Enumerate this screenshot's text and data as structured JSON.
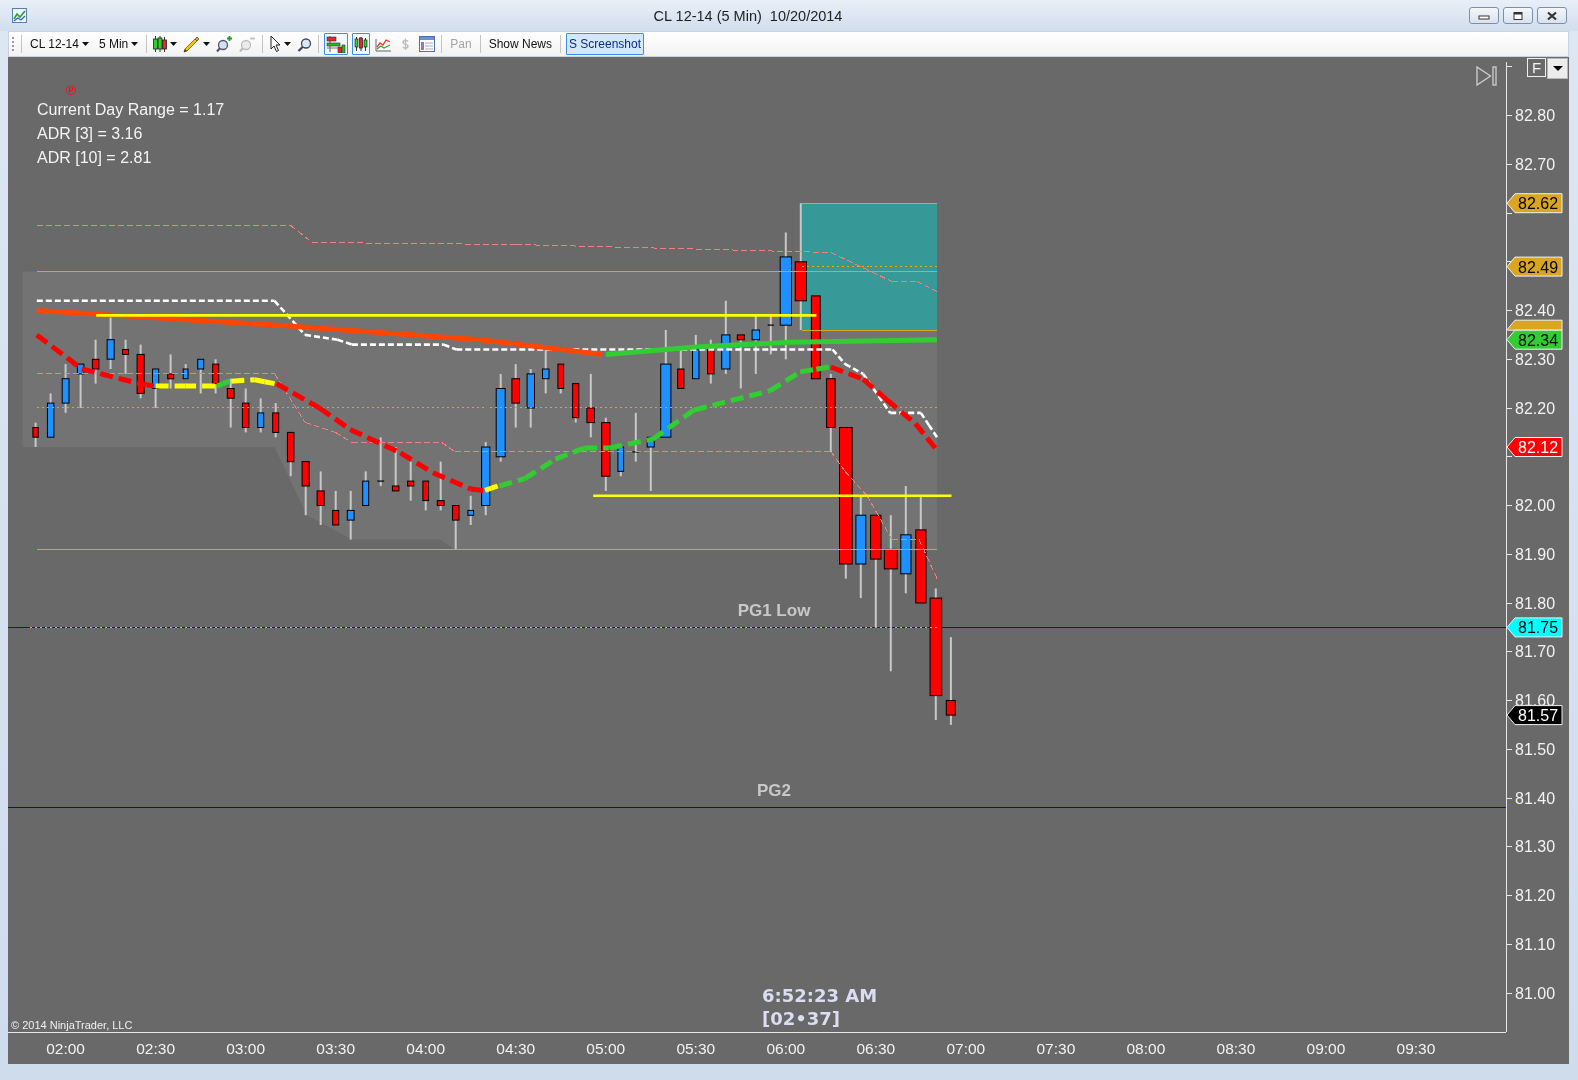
{
  "window": {
    "title": "CL 12-14 (5 Min)  10/20/2014"
  },
  "toolbar": [
    {
      "kind": "grip"
    },
    {
      "kind": "separator"
    },
    {
      "kind": "dropdown",
      "label": "CL 12-14",
      "selected": false,
      "disabled": false
    },
    {
      "kind": "dropdown",
      "label": "5 Min",
      "selected": false,
      "disabled": false
    },
    {
      "kind": "separator"
    },
    {
      "kind": "icon_dropdown",
      "selected": false,
      "disabled": false
    },
    {
      "kind": "icon_dropdown",
      "selected": false,
      "disabled": false
    },
    {
      "kind": "icon",
      "selected": false,
      "disabled": false
    },
    {
      "kind": "icon",
      "selected": false,
      "disabled": true
    },
    {
      "kind": "separator"
    },
    {
      "kind": "icon_dropdown",
      "selected": false,
      "disabled": false
    },
    {
      "kind": "icon",
      "selected": false,
      "disabled": false
    },
    {
      "kind": "separator"
    },
    {
      "kind": "icon",
      "selected": true,
      "disabled": false
    },
    {
      "kind": "icon",
      "selected": true,
      "disabled": false
    },
    {
      "kind": "icon",
      "selected": false,
      "disabled": false
    },
    {
      "kind": "icon",
      "selected": false,
      "disabled": true
    },
    {
      "kind": "icon",
      "selected": false,
      "disabled": false
    },
    {
      "kind": "separator"
    },
    {
      "kind": "text",
      "label": "Pan",
      "selected": false,
      "disabled": true
    },
    {
      "kind": "separator"
    },
    {
      "kind": "text",
      "label": "Show News",
      "selected": false,
      "disabled": false
    },
    {
      "kind": "separator"
    },
    {
      "kind": "text",
      "label": "S Screenshot",
      "selected": true,
      "disabled": false
    }
  ],
  "chart": {
    "overlay": {
      "marker": "℗",
      "info_lines": [
        "Current Day Range = 1.17",
        "ADR [3] = 3.16",
        "ADR [10] = 2.81"
      ],
      "clock": "6:52:23 AM",
      "bar_timer": "[02•37]",
      "copyright": "© 2014 NinjaTrader, LLC",
      "scale_button": "F"
    },
    "price_tags": [
      {
        "label": "82.62",
        "color": "#daa520"
      },
      {
        "label": "82.49",
        "color": "#daa520"
      },
      {
        "color": "#daa520"
      },
      {
        "label": "82.34",
        "color": "#32cd32"
      },
      {
        "label": "82.12",
        "color": "#ff0000"
      },
      {
        "label": "81.75",
        "color": "#00ffff"
      },
      {
        "label": "81.57",
        "color": "#000000"
      }
    ],
    "chart_data": {
      "type": "candlestick",
      "xlim": [
        1.68,
        10
      ],
      "ylim": [
        80.92,
        82.92
      ],
      "x": [
        1.8333,
        1.9167,
        2,
        2.0833,
        2.1667,
        2.25,
        2.3333,
        2.4167,
        2.5,
        2.5833,
        2.6667,
        2.75,
        2.8333,
        2.9167,
        3,
        3.0833,
        3.1667,
        3.25,
        3.3333,
        3.4167,
        3.5,
        3.5833,
        3.6667,
        3.75,
        3.8333,
        3.9167,
        4,
        4.0833,
        4.1667,
        4.25,
        4.3333,
        4.4167,
        4.5,
        4.5833,
        4.6667,
        4.75,
        4.8333,
        4.9167,
        5,
        5.0833,
        5.1667,
        5.25,
        5.3333,
        5.4167,
        5.5,
        5.5833,
        5.6667,
        5.75,
        5.8333,
        5.9167,
        6,
        6.0833,
        6.1667,
        6.25,
        6.3333,
        6.4167,
        6.5,
        6.5833,
        6.6667,
        6.75,
        6.8333,
        6.9167
      ],
      "ohlc": [
        [
          82.16,
          82.17,
          82.12,
          82.14
        ],
        [
          82.14,
          82.23,
          82.14,
          82.21
        ],
        [
          82.21,
          82.29,
          82.19,
          82.26
        ],
        [
          82.27,
          82.29,
          82.2,
          82.29
        ],
        [
          82.3,
          82.34,
          82.25,
          82.28
        ],
        [
          82.3,
          82.39,
          82.28,
          82.34
        ],
        [
          82.32,
          82.34,
          82.27,
          82.31
        ],
        [
          82.31,
          82.33,
          82.22,
          82.23
        ],
        [
          82.24,
          82.28,
          82.2,
          82.28
        ],
        [
          82.27,
          82.31,
          82.24,
          82.26
        ],
        [
          82.26,
          82.29,
          82.26,
          82.28
        ],
        [
          82.28,
          82.3,
          82.23,
          82.3
        ],
        [
          82.29,
          82.3,
          82.23,
          82.25
        ],
        [
          82.24,
          82.26,
          82.16,
          82.22
        ],
        [
          82.21,
          82.24,
          82.15,
          82.16
        ],
        [
          82.16,
          82.22,
          82.15,
          82.19
        ],
        [
          82.19,
          82.21,
          82.14,
          82.15
        ],
        [
          82.15,
          82.15,
          82.06,
          82.09
        ],
        [
          82.09,
          82.09,
          81.98,
          82.04
        ],
        [
          82.03,
          82.07,
          81.96,
          82
        ],
        [
          81.99,
          82.03,
          81.96,
          81.96
        ],
        [
          81.97,
          82.03,
          81.93,
          81.99
        ],
        [
          82,
          82.07,
          82,
          82.05
        ],
        [
          82.05,
          82.14,
          82.04,
          82.05
        ],
        [
          82.04,
          82.12,
          82.03,
          82.03
        ],
        [
          82.05,
          82.09,
          82.01,
          82.04
        ],
        [
          82.05,
          82.05,
          81.99,
          82.01
        ],
        [
          82.01,
          82.09,
          81.99,
          82
        ],
        [
          82,
          82,
          81.91,
          81.97
        ],
        [
          81.98,
          82.02,
          81.96,
          81.99
        ],
        [
          82,
          82.13,
          81.98,
          82.12
        ],
        [
          82.1,
          82.27,
          82.09,
          82.24
        ],
        [
          82.26,
          82.29,
          82.16,
          82.21
        ],
        [
          82.2,
          82.28,
          82.16,
          82.27
        ],
        [
          82.26,
          82.32,
          82.23,
          82.28
        ],
        [
          82.29,
          82.29,
          82.23,
          82.24
        ],
        [
          82.25,
          82.25,
          82.17,
          82.18
        ],
        [
          82.2,
          82.27,
          82.14,
          82.17
        ],
        [
          82.17,
          82.18,
          82.03,
          82.06
        ],
        [
          82.07,
          82.12,
          82.06,
          82.12
        ],
        [
          82.11,
          82.19,
          82.09,
          82.11
        ],
        [
          82.12,
          82.14,
          82.03,
          82.14
        ],
        [
          82.14,
          82.36,
          82.14,
          82.29
        ],
        [
          82.28,
          82.32,
          82.24,
          82.24
        ],
        [
          82.26,
          82.35,
          82.26,
          82.32
        ],
        [
          82.32,
          82.34,
          82.25,
          82.27
        ],
        [
          82.28,
          82.42,
          82.27,
          82.35
        ],
        [
          82.35,
          82.35,
          82.24,
          82.34
        ],
        [
          82.34,
          82.39,
          82.27,
          82.36
        ],
        [
          82.37,
          82.39,
          82.31,
          82.37
        ],
        [
          82.37,
          82.56,
          82.3,
          82.51
        ],
        [
          82.5,
          82.62,
          82.36,
          82.42
        ],
        [
          82.43,
          82.43,
          82.26,
          82.26
        ],
        [
          82.26,
          82.27,
          82.11,
          82.16
        ],
        [
          82.16,
          82.16,
          81.85,
          81.88
        ],
        [
          81.88,
          82.02,
          81.81,
          81.98
        ],
        [
          81.98,
          81.98,
          81.75,
          81.89
        ],
        [
          81.91,
          81.98,
          81.66,
          81.87
        ],
        [
          81.86,
          82.04,
          81.82,
          81.94
        ],
        [
          81.95,
          82.02,
          81.8,
          81.8
        ],
        [
          81.81,
          81.83,
          81.56,
          81.61
        ],
        [
          81.6,
          81.73,
          81.55,
          81.57
        ]
      ],
      "xticks": [
        {
          "value": 2,
          "label": "02:00"
        },
        {
          "value": 2.5,
          "label": "02:30"
        },
        {
          "value": 3,
          "label": "03:00"
        },
        {
          "value": 3.5,
          "label": "03:30"
        },
        {
          "value": 4,
          "label": "04:00"
        },
        {
          "value": 4.5,
          "label": "04:30"
        },
        {
          "value": 5,
          "label": "05:00"
        },
        {
          "value": 5.5,
          "label": "05:30"
        },
        {
          "value": 6,
          "label": "06:00"
        },
        {
          "value": 6.5,
          "label": "06:30"
        },
        {
          "value": 7,
          "label": "07:00"
        },
        {
          "value": 7.5,
          "label": "07:30"
        },
        {
          "value": 8,
          "label": "08:00"
        },
        {
          "value": 8.5,
          "label": "08:30"
        },
        {
          "value": 9,
          "label": "09:00"
        },
        {
          "value": 9.5,
          "label": "09:30"
        }
      ],
      "yticks": [
        {
          "value": 81,
          "label": "81.00"
        },
        {
          "value": 81.1,
          "label": "81.10"
        },
        {
          "value": 81.2,
          "label": "81.20"
        },
        {
          "value": 81.3,
          "label": "81.30"
        },
        {
          "value": 81.4,
          "label": "81.40"
        },
        {
          "value": 81.5,
          "label": "81.50"
        },
        {
          "value": 81.6,
          "label": "81.60"
        },
        {
          "value": 81.7,
          "label": "81.70"
        },
        {
          "value": 81.8,
          "label": "81.80"
        },
        {
          "value": 81.9,
          "label": "81.90"
        },
        {
          "value": 82,
          "label": "82.00"
        },
        {
          "value": 82.2,
          "label": "82.20"
        },
        {
          "value": 82.3,
          "label": "82.30"
        },
        {
          "value": 82.4,
          "label": "82.40"
        },
        {
          "value": 82.7,
          "label": "82.70"
        },
        {
          "value": 82.8,
          "label": "82.80"
        }
      ],
      "series": [
        {
          "type": "line",
          "color": "#daa520",
          "line_style": "solid",
          "x": [
            6.09,
            6.84
          ],
          "values": [
            82.62,
            82.62
          ]
        },
        {
          "type": "line",
          "color": "#daa520",
          "line_style": "solid",
          "x": [
            6.09,
            6.84
          ],
          "values": [
            82.36,
            82.36
          ]
        },
        {
          "type": "line",
          "color": "#ffa500",
          "line_style": "dotted",
          "x": [
            6.09,
            6.84
          ],
          "values": [
            82.49,
            82.49
          ]
        },
        {
          "type": "line",
          "color": "#daa520",
          "line_style": "solid",
          "x": [
            1.84,
            6.84
          ],
          "values": [
            82.48,
            82.48
          ]
        },
        {
          "type": "line",
          "color": "#daa520",
          "line_style": "dotted",
          "x": [
            1.84,
            6.84
          ],
          "values": [
            82.2,
            82.2
          ]
        },
        {
          "type": "line",
          "color": "#daa520",
          "line_style": "solid",
          "x": [
            1.84,
            6.84
          ],
          "values": [
            81.91,
            81.91
          ]
        },
        {
          "type": "line",
          "color": "#00ffff",
          "line_style": "dotted",
          "x": [
            1.8,
            6.84
          ],
          "values": [
            81.75,
            81.75
          ]
        },
        {
          "type": "line",
          "color": "#f08080",
          "line_style": "dashed",
          "x": [
            1.84,
            3.25,
            3.37,
            4.5,
            6.25,
            6.59,
            6.73,
            6.84
          ],
          "values": [
            82.575,
            82.575,
            82.54,
            82.535,
            82.52,
            82.46,
            82.46,
            82.44
          ]
        },
        {
          "type": "line",
          "color": "#f08080",
          "line_style": "dashed",
          "x": [
            1.84,
            3.16,
            3.33,
            3.5,
            3.59,
            4.09,
            4.16,
            6.25,
            6.33,
            6.45,
            6.59,
            6.74,
            6.84
          ],
          "values": [
            82.27,
            82.27,
            82.17,
            82.15,
            82.13,
            82.13,
            82.11,
            82.11,
            82.07,
            82.02,
            81.93,
            81.93,
            81.85
          ]
        },
        {
          "type": "line",
          "color": "#ffffff",
          "line_style": "dashed",
          "x": [
            1.84,
            3.16,
            3.33,
            3.51,
            3.59,
            4.1,
            4.17,
            6.26,
            6.33,
            6.43,
            6.58,
            6.75,
            6.84
          ],
          "values": [
            82.42,
            82.42,
            82.35,
            82.34,
            82.33,
            82.33,
            82.32,
            82.32,
            82.29,
            82.27,
            82.19,
            82.19,
            82.14
          ]
        },
        {
          "type": "line",
          "color": "#ff4500",
          "line_style": "solid",
          "x": [
            1.84,
            3.16,
            4.3,
            4.98
          ],
          "values": [
            82.4,
            82.37,
            82.34,
            82.31
          ]
        },
        {
          "type": "line",
          "color": "#32cd32",
          "line_style": "solid",
          "x": [
            5,
            5.5,
            6.03,
            6.84
          ],
          "values": [
            82.31,
            82.325,
            82.335,
            82.34
          ]
        },
        {
          "type": "line",
          "color": "#ff0000",
          "line_style": "dashed",
          "x": [
            1.84,
            2.09,
            2.41,
            2.49
          ],
          "values": [
            82.35,
            82.28,
            82.25,
            82.245
          ]
        },
        {
          "type": "line",
          "color": "#ffff00",
          "line_style": "dashed",
          "x": [
            2.5,
            2.83
          ],
          "values": [
            82.245,
            82.245
          ]
        },
        {
          "type": "line",
          "color": "#32cd32",
          "line_style": "dashed",
          "x": [
            2.84,
            2.91
          ],
          "values": [
            82.245,
            82.255
          ]
        },
        {
          "type": "line",
          "color": "#ffff00",
          "line_style": "dashed",
          "x": [
            2.92,
            3.05,
            3.16
          ],
          "values": [
            82.255,
            82.258,
            82.25
          ]
        },
        {
          "type": "line",
          "color": "#ff0000",
          "line_style": "dashed",
          "x": [
            3.17,
            3.41,
            3.58,
            3.86,
            4.04,
            4.25,
            4.32
          ],
          "values": [
            82.25,
            82.2,
            82.156,
            82.108,
            82.067,
            82.034,
            82.031
          ]
        },
        {
          "type": "line",
          "color": "#ffff00",
          "line_style": "dashed",
          "x": [
            4.33,
            4.4
          ],
          "values": [
            82.031,
            82.04
          ]
        },
        {
          "type": "line",
          "color": "#32cd32",
          "line_style": "dashed",
          "x": [
            4.41,
            4.55,
            4.72,
            4.88,
            5.02,
            5.26,
            5.49,
            5.91,
            6.08,
            6.24
          ],
          "values": [
            82.04,
            82.055,
            82.095,
            82.118,
            82.118,
            82.136,
            82.196,
            82.235,
            82.274,
            82.284
          ]
        },
        {
          "type": "line",
          "color": "#ff0000",
          "line_style": "dashed",
          "x": [
            6.25,
            6.43,
            6.56,
            6.72,
            6.83
          ],
          "values": [
            82.284,
            82.259,
            82.217,
            82.168,
            82.118
          ]
        },
        {
          "type": "line",
          "color": "#ffff00",
          "line_style": "solid",
          "x": [
            2.17,
            6.17
          ],
          "values": [
            82.39,
            82.39
          ]
        },
        {
          "type": "line",
          "color": "#ffff00",
          "line_style": "solid",
          "x": [
            4.93,
            6.92
          ],
          "values": [
            82.02,
            82.02
          ]
        }
      ],
      "ref_lines": [
        {
          "axis": "y",
          "value": 81.75,
          "label": "PG1 Low",
          "color": "#0000ff",
          "line_style": "solid"
        },
        {
          "axis": "y",
          "value": 81.38,
          "label": "PG2",
          "color": "#0000ff",
          "line_style": "solid"
        }
      ]
    }
  }
}
